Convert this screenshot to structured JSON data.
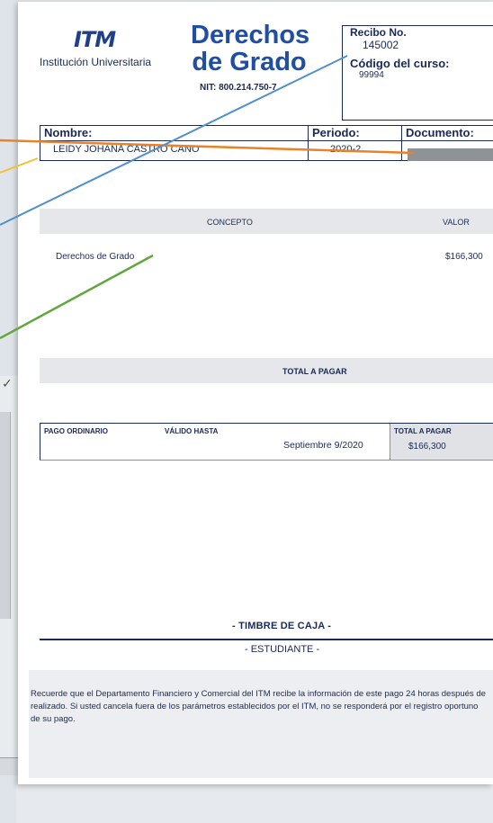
{
  "header": {
    "logo_mark": "ITM",
    "institution": "Institución Universitaria",
    "title_line1": "Derechos",
    "title_line2": "de Grado",
    "nit": "NIT: 800.214.750-7"
  },
  "receipt": {
    "recibo_label": "Recibo No.",
    "recibo_value": "145002",
    "codigo_label": "Código del curso:",
    "codigo_value": "99994"
  },
  "info": {
    "nombre_label": "Nombre:",
    "nombre_value": "LEIDY JOHANA CASTRO CANO",
    "periodo_label": "Periodo:",
    "periodo_value": "2020-2",
    "documento_label": "Documento:"
  },
  "concept": {
    "concepto_label": "CONCEPTO",
    "valor_label": "VALOR",
    "item_label": "Derechos de Grado",
    "item_value": "$166,300"
  },
  "total": {
    "label": "TOTAL A PAGAR"
  },
  "payment": {
    "pago_label": "PAGO ORDINARIO",
    "valido_label": "VÁLIDO HASTA",
    "date": "Septiembre 9/2020",
    "total_label": "TOTAL A PAGAR",
    "total_value": "$166,300"
  },
  "footer": {
    "timbre": "- TIMBRE DE CAJA -",
    "estudiante": "- ESTUDIANTE -",
    "note": "Recuerde que el Departamento Financiero y Comercial del ITM recibe la información de este pago 24 horas después de realizado. Si usted cancela fuera de los parámetros establecidos por el ITM, no se responderá por el registro oportuno de su pago."
  },
  "annotation_colors": [
    "#e8832a",
    "#f2c230",
    "#4f8fcf",
    "#5fa83b"
  ]
}
